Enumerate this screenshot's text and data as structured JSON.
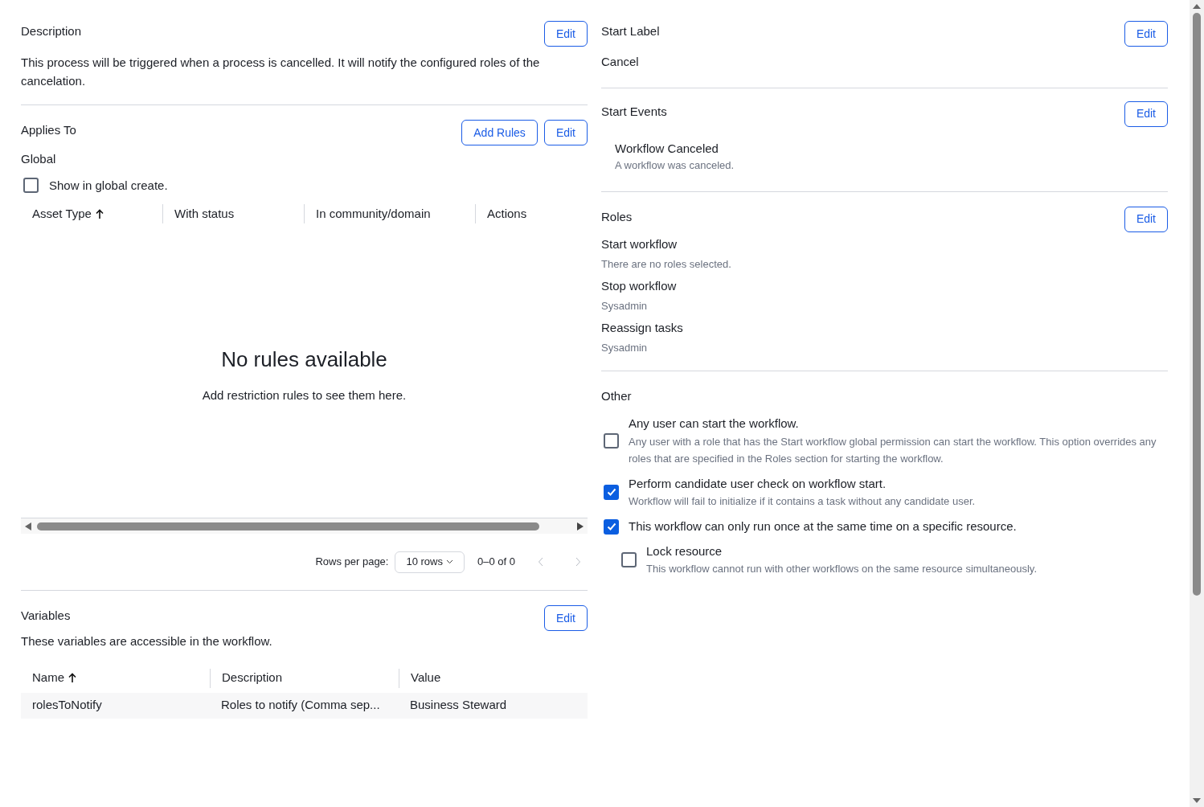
{
  "description": {
    "title": "Description",
    "edit_button": "Edit",
    "text": "This process will be triggered when a process is cancelled. It will notify the configured roles of the cancelation."
  },
  "applies_to": {
    "title": "Applies To",
    "add_rules_button": "Add Rules",
    "edit_button": "Edit",
    "value": "Global",
    "show_in_global_create": {
      "label": "Show in global create.",
      "checked": false
    },
    "table": {
      "columns": [
        {
          "label": "Asset Type",
          "sorted": true
        },
        {
          "label": "With status",
          "sorted": false
        },
        {
          "label": "In community/domain",
          "sorted": false
        },
        {
          "label": "Actions",
          "sorted": false
        }
      ],
      "empty_title": "No rules available",
      "empty_text": "Add restriction rules to see them here."
    },
    "pagination": {
      "rows_per_page_label": "Rows per page:",
      "rows_value": "10 rows",
      "range": "0–0 of 0"
    }
  },
  "variables": {
    "title": "Variables",
    "edit_button": "Edit",
    "text": "These variables are accessible in the workflow.",
    "table": {
      "columns": [
        {
          "label": "Name",
          "sorted": true
        },
        {
          "label": "Description",
          "sorted": false
        },
        {
          "label": "Value",
          "sorted": false
        }
      ],
      "rows": [
        {
          "cells": [
            "rolesToNotify",
            "Roles to notify (Comma sep...",
            "Business Steward"
          ]
        }
      ]
    }
  },
  "start_label": {
    "title": "Start Label",
    "edit_button": "Edit",
    "value": "Cancel"
  },
  "start_events": {
    "title": "Start Events",
    "edit_button": "Edit",
    "events": [
      {
        "name": "Workflow Canceled",
        "description": "A workflow was canceled."
      }
    ]
  },
  "roles": {
    "title": "Roles",
    "edit_button": "Edit",
    "items": [
      {
        "name": "Start workflow",
        "value": "There are no roles selected."
      },
      {
        "name": "Stop workflow",
        "value": "Sysadmin"
      },
      {
        "name": "Reassign tasks",
        "value": "Sysadmin"
      }
    ]
  },
  "other": {
    "title": "Other",
    "options": [
      {
        "label": "Any user can start the workflow.",
        "description": "Any user with a role that has the Start workflow global permission can start the workflow. This option overrides any roles that are specified in the Roles section for starting the workflow.",
        "checked": false
      },
      {
        "label": "Perform candidate user check on workflow start.",
        "description": "Workflow will fail to initialize if it contains a task without any candidate user.",
        "checked": true
      },
      {
        "label": "This workflow can only run once at the same time on a specific resource.",
        "checked": true,
        "children": [
          {
            "label": "Lock resource",
            "description": "This workflow cannot run with other workflows on the same resource simultaneously.",
            "checked": false
          }
        ]
      }
    ]
  }
}
